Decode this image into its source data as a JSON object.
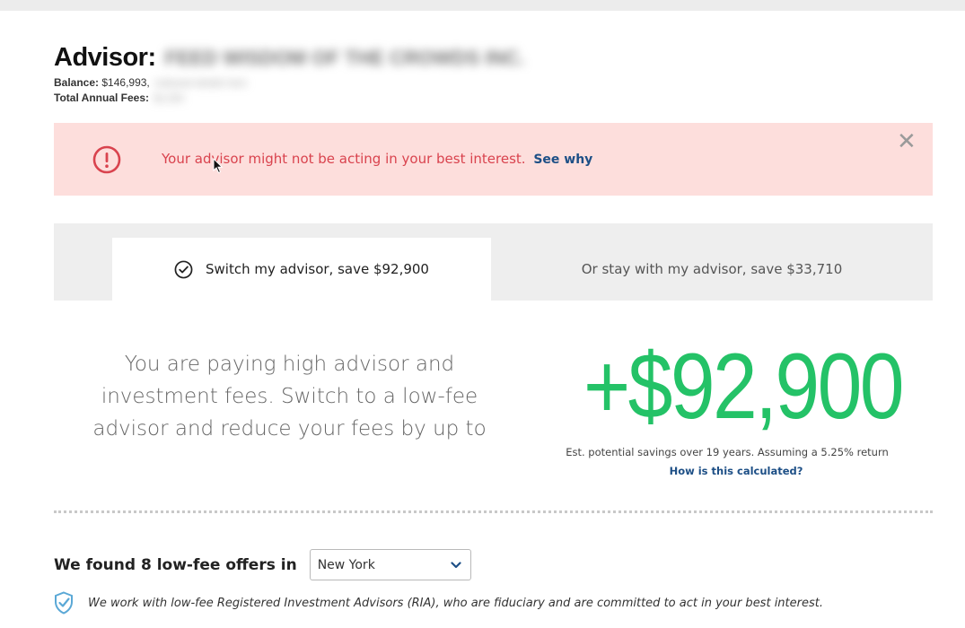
{
  "header": {
    "advisor_label": "Advisor:",
    "advisor_name": "FEED WISDOM OF THE CROWDS INC.",
    "balance_label": "Balance:",
    "balance_value": "$146,993,",
    "balance_extra": "redacted details here",
    "fees_label": "Total Annual Fees:",
    "fees_value": "$1,000"
  },
  "alert": {
    "message": "Your advisor might not be acting in your best interest.",
    "link": "See why",
    "icon": "exclamation-circle-icon",
    "close_icon": "close-icon",
    "close_glyph": "✕",
    "color": "#d9434e",
    "background": "#fddedc"
  },
  "tabs": [
    {
      "label": "Switch my advisor, save $92,900",
      "active": true,
      "icon": "checkmark-circle-icon"
    },
    {
      "label": "Or stay with my advisor, save $33,710",
      "active": false
    }
  ],
  "pitch": {
    "line1": "You are paying high advisor and",
    "line2": "investment fees. Switch to a low-fee",
    "line3": "advisor and reduce your fees by up to"
  },
  "savings": {
    "amount": "+$92,900",
    "note": "Est. potential savings over 19 years. Assuming a 5.25% return",
    "link": "How is this calculated?",
    "color": "#24c267"
  },
  "offers": {
    "title": "We found 8 low-fee offers in",
    "location": "New York",
    "dropdown_icon": "chevron-down-icon"
  },
  "ria": {
    "icon": "shield-check-icon",
    "text": "We work with low-fee Registered Investment Advisors (RIA), who are fiduciary and are committed to act in your best interest."
  }
}
